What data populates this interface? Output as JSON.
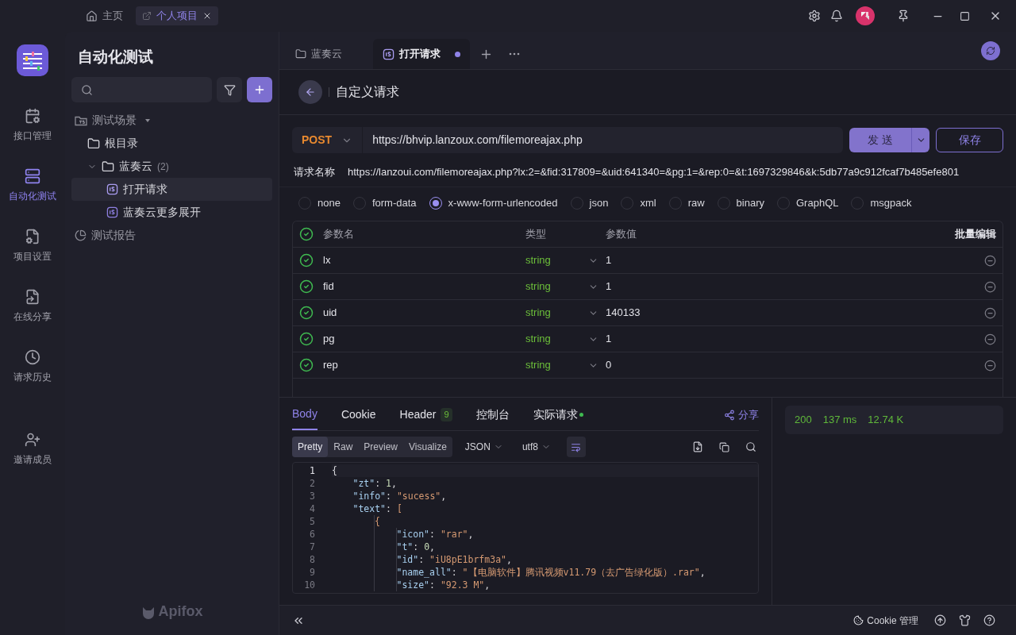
{
  "title_bar": {
    "tabs": [
      {
        "label": "主页",
        "kind": "home",
        "selected": false
      },
      {
        "label": "个人项目",
        "kind": "project",
        "selected": true
      }
    ]
  },
  "nav_rail": {
    "items": [
      {
        "label": "接口管理",
        "selected": false
      },
      {
        "label": "自动化测试",
        "selected": true
      },
      {
        "label": "项目设置",
        "selected": false
      },
      {
        "label": "在线分享",
        "selected": false
      },
      {
        "label": "请求历史",
        "selected": false
      },
      {
        "label": "邀请成员",
        "selected": false
      }
    ]
  },
  "sidebar": {
    "title": "自动化测试",
    "brand": "Apifox",
    "tree": [
      {
        "label": "测试场景",
        "kind": "section",
        "expanded": true,
        "children": [
          {
            "label": "根目录",
            "kind": "folder"
          },
          {
            "label": "蓝奏云",
            "kind": "folder",
            "count": "(2)",
            "expanded": true,
            "children": [
              {
                "label": "打开请求",
                "kind": "case",
                "selected": true
              },
              {
                "label": "蓝奏云更多展开",
                "kind": "case",
                "selected": false
              }
            ]
          }
        ]
      },
      {
        "label": "测试报告",
        "kind": "report"
      }
    ]
  },
  "editor_tabs": [
    {
      "label": "蓝奏云",
      "kind": "folder",
      "selected": false,
      "unsaved": false
    },
    {
      "label": "打开请求",
      "kind": "case",
      "selected": true,
      "unsaved": true
    }
  ],
  "header": {
    "title": "自定义请求"
  },
  "request": {
    "method": "POST",
    "url": "https://bhvip.lanzoux.com/filemoreajax.php",
    "send": "发 送",
    "save": "保存",
    "name_label": "请求名称",
    "name": "https://lanzoui.com/filemoreajax.php?lx:2=&fid:317809=&uid:641340=&pg:1=&rep:0=&t:1697329846&k:5db77a9c912fcaf7b485efe801"
  },
  "body_types": [
    {
      "label": "none",
      "selected": false
    },
    {
      "label": "form-data",
      "selected": false
    },
    {
      "label": "x-www-form-urlencoded",
      "selected": true
    },
    {
      "label": "json",
      "selected": false
    },
    {
      "label": "xml",
      "selected": false
    },
    {
      "label": "raw",
      "selected": false
    },
    {
      "label": "binary",
      "selected": false
    },
    {
      "label": "GraphQL",
      "selected": false
    },
    {
      "label": "msgpack",
      "selected": false
    }
  ],
  "params": {
    "columns": [
      "参数名",
      "类型",
      "参数值"
    ],
    "bulk_edit": "批量编辑",
    "all_enabled": true,
    "rows": [
      {
        "name": "lx",
        "type": "string",
        "value": "1",
        "enabled": true
      },
      {
        "name": "fid",
        "type": "string",
        "value": "1",
        "enabled": true
      },
      {
        "name": "uid",
        "type": "string",
        "value": "140133",
        "enabled": true
      },
      {
        "name": "pg",
        "type": "string",
        "value": "1",
        "enabled": true
      },
      {
        "name": "rep",
        "type": "string",
        "value": "0",
        "enabled": true
      }
    ]
  },
  "response": {
    "tabs": [
      {
        "label": "Body",
        "selected": true
      },
      {
        "label": "Cookie",
        "selected": false
      },
      {
        "label": "Header",
        "badge": "9",
        "selected": false
      },
      {
        "label": "控制台",
        "selected": false
      },
      {
        "label": "实际请求",
        "dot": true,
        "selected": false
      }
    ],
    "share": "分享",
    "views": [
      {
        "label": "Pretty",
        "selected": true
      },
      {
        "label": "Raw",
        "selected": false
      },
      {
        "label": "Preview",
        "selected": false
      },
      {
        "label": "Visualize",
        "selected": false
      }
    ],
    "format": "JSON",
    "encoding": "utf8",
    "code": [
      {
        "n": "1",
        "tokens": [
          {
            "kind": "punct",
            "text": "{"
          }
        ],
        "children": [
          {
            "n": "2",
            "tokens": [
              {
                "kind": "key",
                "text": "\"zt\""
              },
              {
                "kind": "punct",
                "text": ": "
              },
              {
                "kind": "number",
                "text": "1"
              },
              {
                "kind": "punct",
                "text": ","
              }
            ]
          },
          {
            "n": "3",
            "tokens": [
              {
                "kind": "key",
                "text": "\"info\""
              },
              {
                "kind": "punct",
                "text": ": "
              },
              {
                "kind": "string",
                "text": "\"sucess\""
              },
              {
                "kind": "punct",
                "text": ","
              }
            ]
          },
          {
            "n": "4",
            "tokens": [
              {
                "kind": "key",
                "text": "\"text\""
              },
              {
                "kind": "punct",
                "text": ": "
              },
              {
                "kind": "string",
                "text": "["
              }
            ],
            "children": [
              {
                "n": "5",
                "tokens": [
                  {
                    "kind": "string",
                    "text": "{"
                  }
                ],
                "children": [
                  {
                    "n": "6",
                    "tokens": [
                      {
                        "kind": "key",
                        "text": "\"icon\""
                      },
                      {
                        "kind": "punct",
                        "text": ": "
                      },
                      {
                        "kind": "string",
                        "text": "\"rar\""
                      },
                      {
                        "kind": "punct",
                        "text": ","
                      }
                    ]
                  },
                  {
                    "n": "7",
                    "tokens": [
                      {
                        "kind": "key",
                        "text": "\"t\""
                      },
                      {
                        "kind": "punct",
                        "text": ": "
                      },
                      {
                        "kind": "number",
                        "text": "0"
                      },
                      {
                        "kind": "punct",
                        "text": ","
                      }
                    ]
                  },
                  {
                    "n": "8",
                    "tokens": [
                      {
                        "kind": "key",
                        "text": "\"id\""
                      },
                      {
                        "kind": "punct",
                        "text": ": "
                      },
                      {
                        "kind": "string",
                        "text": "\"iU8pE1brfm3a\""
                      },
                      {
                        "kind": "punct",
                        "text": ","
                      }
                    ]
                  },
                  {
                    "n": "9",
                    "tokens": [
                      {
                        "kind": "key",
                        "text": "\"name_all\""
                      },
                      {
                        "kind": "punct",
                        "text": ": "
                      },
                      {
                        "kind": "string",
                        "text": "\"【电脑软件】腾讯视频v11.79（去广告绿化版）.rar\""
                      },
                      {
                        "kind": "punct",
                        "text": ","
                      }
                    ]
                  },
                  {
                    "n": "10",
                    "tokens": [
                      {
                        "kind": "key",
                        "text": "\"size\""
                      },
                      {
                        "kind": "punct",
                        "text": ": "
                      },
                      {
                        "kind": "string",
                        "text": "\"92.3 M\""
                      },
                      {
                        "kind": "punct",
                        "text": ","
                      }
                    ]
                  }
                ]
              }
            ]
          }
        ]
      }
    ]
  },
  "status": {
    "code": "200",
    "time": "137 ms",
    "size": "12.74 K"
  },
  "bottom_bar": {
    "cookie": "Cookie 管理"
  }
}
